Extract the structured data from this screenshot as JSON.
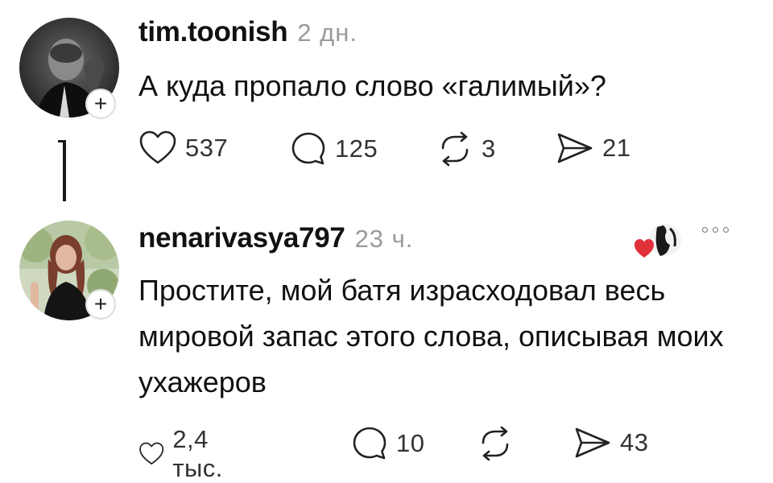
{
  "comments": [
    {
      "username": "tim.toonish",
      "time": "2 дн.",
      "text": "А куда пропало слово «галимый»?",
      "likes": "537",
      "replies": "125",
      "reposts": "3",
      "shares": "21",
      "follow_symbol": "+"
    },
    {
      "username": "nenarivasya797",
      "time": "23 ч.",
      "text": "Простите, мой батя израсходовал весь мировой запас этого слова, описывая моих ухажеров",
      "likes": "2,4 тыс.",
      "replies": "10",
      "reposts": "",
      "shares": "43",
      "follow_symbol": "+"
    }
  ],
  "colors": {
    "text": "#111111",
    "muted": "#9a9a9a",
    "icon": "#222222",
    "heart_badge": "#e0303a"
  },
  "icons": [
    "heart-icon",
    "comment-icon",
    "repost-icon",
    "send-icon",
    "plus-icon",
    "more-icon"
  ]
}
